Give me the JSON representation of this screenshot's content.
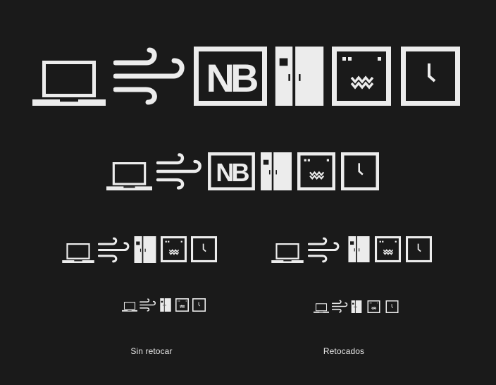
{
  "labels": {
    "left": "Sin retocar",
    "right": "Retocados"
  },
  "icon_color": "#ececec",
  "background_color": "#1a1a1a",
  "logo_text": "NB",
  "rows": [
    {
      "name": "row-large",
      "icons": [
        "laptop-icon",
        "wind-icon",
        "nb-logo-icon",
        "refrigerator-icon",
        "microwave-icon",
        "clock-icon"
      ]
    },
    {
      "name": "row-medium",
      "icons": [
        "laptop-icon",
        "wind-icon",
        "nb-logo-icon",
        "refrigerator-icon",
        "microwave-icon",
        "clock-icon"
      ]
    },
    {
      "name": "row-small-unretouched",
      "icons": [
        "laptop-icon",
        "wind-icon",
        "refrigerator-icon",
        "microwave-icon",
        "clock-icon"
      ]
    },
    {
      "name": "row-small-retouched",
      "icons": [
        "laptop-icon",
        "wind-icon",
        "refrigerator-icon",
        "microwave-icon",
        "clock-icon"
      ]
    },
    {
      "name": "row-tiny-unretouched",
      "icons": [
        "laptop-icon",
        "wind-icon",
        "refrigerator-icon",
        "microwave-icon",
        "clock-icon"
      ]
    },
    {
      "name": "row-tiny-retouched",
      "icons": [
        "laptop-icon",
        "wind-icon",
        "refrigerator-icon",
        "microwave-icon",
        "clock-icon"
      ]
    }
  ]
}
